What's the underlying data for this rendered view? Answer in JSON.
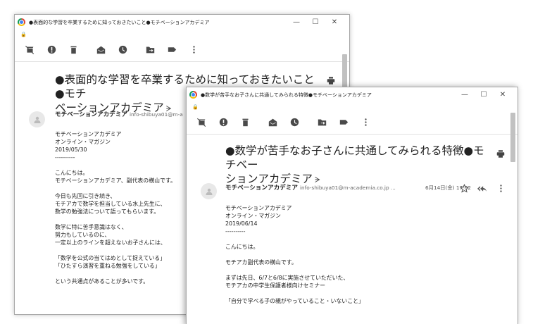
{
  "window_back": {
    "title": "●表面的な学習を卒業するために知っておきたいこと●モチベーションアカデミア",
    "subject_line1": "●表面的な学習を卒業するために知っておきたいこと●モチ",
    "subject_line2": "ベーションアカデミア",
    "sender_name": "モチベーションアカデミア",
    "sender_email": "info-shibuya01@m-a",
    "body": [
      "モチベーションアカデミア",
      "オンライン・マガジン",
      "2019/05/30",
      "----------",
      "",
      "こんにちは。",
      "モチベーションアカデミア、副代表の横山です。",
      "",
      "今日も先回に引き続き、",
      "モチアカで数学を担当している水上先生に、",
      "数学の勉強法について語ってもらいます。",
      "",
      "数学に特に苦手意識はなく、",
      "努力もしているのに、",
      "一定以上のラインを超えないお子さんには、",
      "",
      "「数学を公式の当てはめとして捉えている」",
      "「ひたすら演習を重ねる勉強をしている」",
      "",
      "という共通点があることが多いです。"
    ]
  },
  "window_front": {
    "title": "●数学が苦手なお子さんに共通してみられる特徴●モチベーションアカデミア",
    "subject_line1": "●数学が苦手なお子さんに共通してみられる特徴●モチベー",
    "subject_line2": "ションアカデミア",
    "sender_name": "モチベーションアカデミア",
    "sender_email": "info-shibuya01@m-academia.co.jp ...",
    "date": "6月14日(金) 17:02",
    "body": [
      "モチベーションアカデミア",
      "オンライン・マガジン",
      "2019/06/14",
      "----------",
      "",
      "こんにちは。",
      "",
      "モチアカ副代表の横山です。",
      "",
      "まずは先日、6/7と6/8に実施させていただいた、",
      "モチアカの中学生保護者様向けセミナー",
      "",
      "「自分で学べる子の親がやっていること・いないこと」"
    ]
  },
  "window_controls": {
    "minimize": "—",
    "maximize": "☐",
    "close": "✕"
  },
  "lock_glyph": "🔒",
  "label_glyph": "ᗒ",
  "colors": {
    "window_border": "#a9a9a9",
    "icon": "#4a4a4a",
    "avatar_bg": "#e8e8e8",
    "scrollbar": "#c1c1c1"
  }
}
